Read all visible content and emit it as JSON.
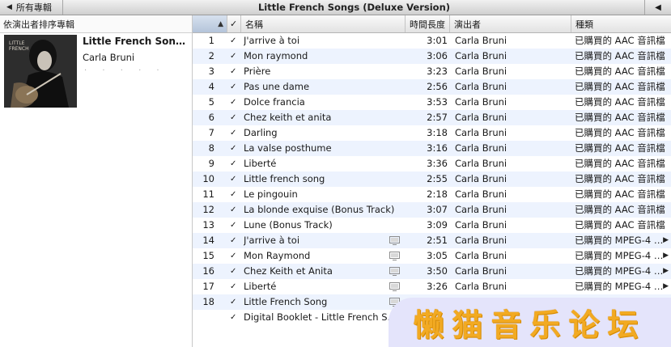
{
  "topbar": {
    "back_label": "所有專輯",
    "title": "Little French Songs (Deluxe Version)"
  },
  "sidebar": {
    "sort_header": "依演出者排序專輯",
    "album_name": "Little French Songs (D…",
    "album_artist": "Carla Bruni",
    "rating_dots": "· · · · ·"
  },
  "columns": {
    "check": "✓",
    "name": "名稱",
    "time": "時間長度",
    "artist": "演出者",
    "kind": "種類"
  },
  "tracks": [
    {
      "num": "1",
      "name": "J'arrive à toi",
      "time": "3:01",
      "artist": "Carla Bruni",
      "kind": "已購買的 AAC 音訊檔",
      "video": false
    },
    {
      "num": "2",
      "name": "Mon raymond",
      "time": "3:06",
      "artist": "Carla Bruni",
      "kind": "已購買的 AAC 音訊檔",
      "video": false
    },
    {
      "num": "3",
      "name": "Prière",
      "time": "3:23",
      "artist": "Carla Bruni",
      "kind": "已購買的 AAC 音訊檔",
      "video": false
    },
    {
      "num": "4",
      "name": "Pas une dame",
      "time": "2:56",
      "artist": "Carla Bruni",
      "kind": "已購買的 AAC 音訊檔",
      "video": false
    },
    {
      "num": "5",
      "name": "Dolce francia",
      "time": "3:53",
      "artist": "Carla Bruni",
      "kind": "已購買的 AAC 音訊檔",
      "video": false
    },
    {
      "num": "6",
      "name": "Chez keith et anita",
      "time": "2:57",
      "artist": "Carla Bruni",
      "kind": "已購買的 AAC 音訊檔",
      "video": false
    },
    {
      "num": "7",
      "name": "Darling",
      "time": "3:18",
      "artist": "Carla Bruni",
      "kind": "已購買的 AAC 音訊檔",
      "video": false
    },
    {
      "num": "8",
      "name": "La valse posthume",
      "time": "3:16",
      "artist": "Carla Bruni",
      "kind": "已購買的 AAC 音訊檔",
      "video": false
    },
    {
      "num": "9",
      "name": "Liberté",
      "time": "3:36",
      "artist": "Carla Bruni",
      "kind": "已購買的 AAC 音訊檔",
      "video": false
    },
    {
      "num": "10",
      "name": "Little french song",
      "time": "2:55",
      "artist": "Carla Bruni",
      "kind": "已購買的 AAC 音訊檔",
      "video": false
    },
    {
      "num": "11",
      "name": "Le pingouin",
      "time": "2:18",
      "artist": "Carla Bruni",
      "kind": "已購買的 AAC 音訊檔",
      "video": false
    },
    {
      "num": "12",
      "name": "La blonde exquise (Bonus Track)",
      "time": "3:07",
      "artist": "Carla Bruni",
      "kind": "已購買的 AAC 音訊檔",
      "video": false
    },
    {
      "num": "13",
      "name": "Lune (Bonus Track)",
      "time": "3:09",
      "artist": "Carla Bruni",
      "kind": "已購買的 AAC 音訊檔",
      "video": false
    },
    {
      "num": "14",
      "name": "J'arrive à toi",
      "time": "2:51",
      "artist": "Carla Bruni",
      "kind": "已購買的 MPEG-4 視…",
      "video": true
    },
    {
      "num": "15",
      "name": "Mon Raymond",
      "time": "3:05",
      "artist": "Carla Bruni",
      "kind": "已購買的 MPEG-4 視…",
      "video": true
    },
    {
      "num": "16",
      "name": "Chez Keith et Anita",
      "time": "3:50",
      "artist": "Carla Bruni",
      "kind": "已購買的 MPEG-4 視…",
      "video": true
    },
    {
      "num": "17",
      "name": "Liberté",
      "time": "3:26",
      "artist": "Carla Bruni",
      "kind": "已購買的 MPEG-4 視…",
      "video": true
    },
    {
      "num": "18",
      "name": "Little French Song",
      "time": "",
      "artist": "",
      "kind": "",
      "video": true
    },
    {
      "num": "",
      "name": "Digital Booklet - Little French S…",
      "time": "",
      "artist": "",
      "kind": "",
      "video": false
    }
  ],
  "watermark": "懒猫音乐论坛",
  "colors": {
    "row_stripe": "#edf3fe",
    "sorted_column": "#c4d1e3",
    "watermark_text": "#f2aa22",
    "watermark_bg": "#e4e4fb"
  }
}
